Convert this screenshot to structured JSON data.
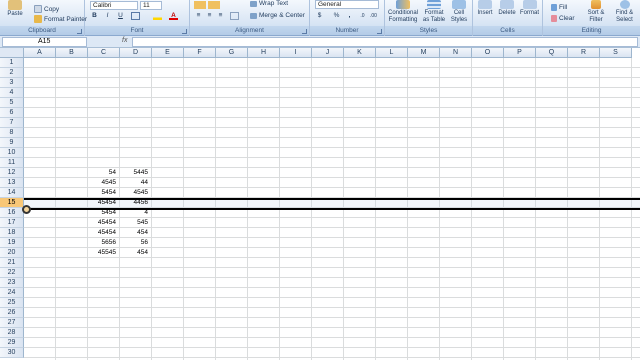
{
  "ribbon": {
    "clipboard": {
      "label": "Clipboard",
      "paste": "Paste",
      "copy": "Copy",
      "format_painter": "Format Painter"
    },
    "font": {
      "label": "Font",
      "name": "Calibri",
      "size": "11",
      "bold": "B",
      "italic": "I",
      "underline": "U"
    },
    "alignment": {
      "label": "Alignment",
      "wrap_text": "Wrap Text",
      "merge_center": "Merge & Center"
    },
    "number": {
      "label": "Number",
      "format": "General",
      "currency": "$",
      "percent": "%",
      "comma": ","
    },
    "styles": {
      "label": "Styles",
      "conditional_formatting": "Conditional Formatting",
      "format_as_table": "Format as Table",
      "cell_styles": "Cell Styles"
    },
    "cells": {
      "label": "Cells",
      "insert": "Insert",
      "delete": "Delete",
      "format": "Format"
    },
    "editing": {
      "label": "Editing",
      "fill": "Fill",
      "clear": "Clear",
      "sort_filter": "Sort & Filter",
      "find_select": "Find & Select"
    }
  },
  "formula_bar": {
    "name_box": "A15",
    "fx": "fx",
    "value": ""
  },
  "columns": [
    "A",
    "B",
    "C",
    "D",
    "E",
    "F",
    "G",
    "H",
    "I",
    "J",
    "K",
    "L",
    "M",
    "N",
    "O",
    "P",
    "Q",
    "R",
    "S"
  ],
  "rows": [
    "1",
    "2",
    "3",
    "4",
    "5",
    "6",
    "7",
    "8",
    "9",
    "10",
    "11",
    "12",
    "13",
    "14",
    "15",
    "16",
    "17",
    "18",
    "19",
    "20",
    "21",
    "22",
    "23",
    "24",
    "25",
    "26",
    "27",
    "28",
    "29",
    "30"
  ],
  "selected_row": "15",
  "cells": {
    "C": [
      "54",
      "4545",
      "5454",
      "45454",
      "5454",
      "45454",
      "45454",
      "5656",
      "45545"
    ],
    "D": [
      "5445",
      "44",
      "4545",
      "4456",
      "4",
      "545",
      "454",
      "56",
      "454"
    ]
  },
  "colors": {
    "selection_header": "#f8c777",
    "ribbon_bg": "#dbe7f5",
    "gridline": "#dadcdd"
  }
}
